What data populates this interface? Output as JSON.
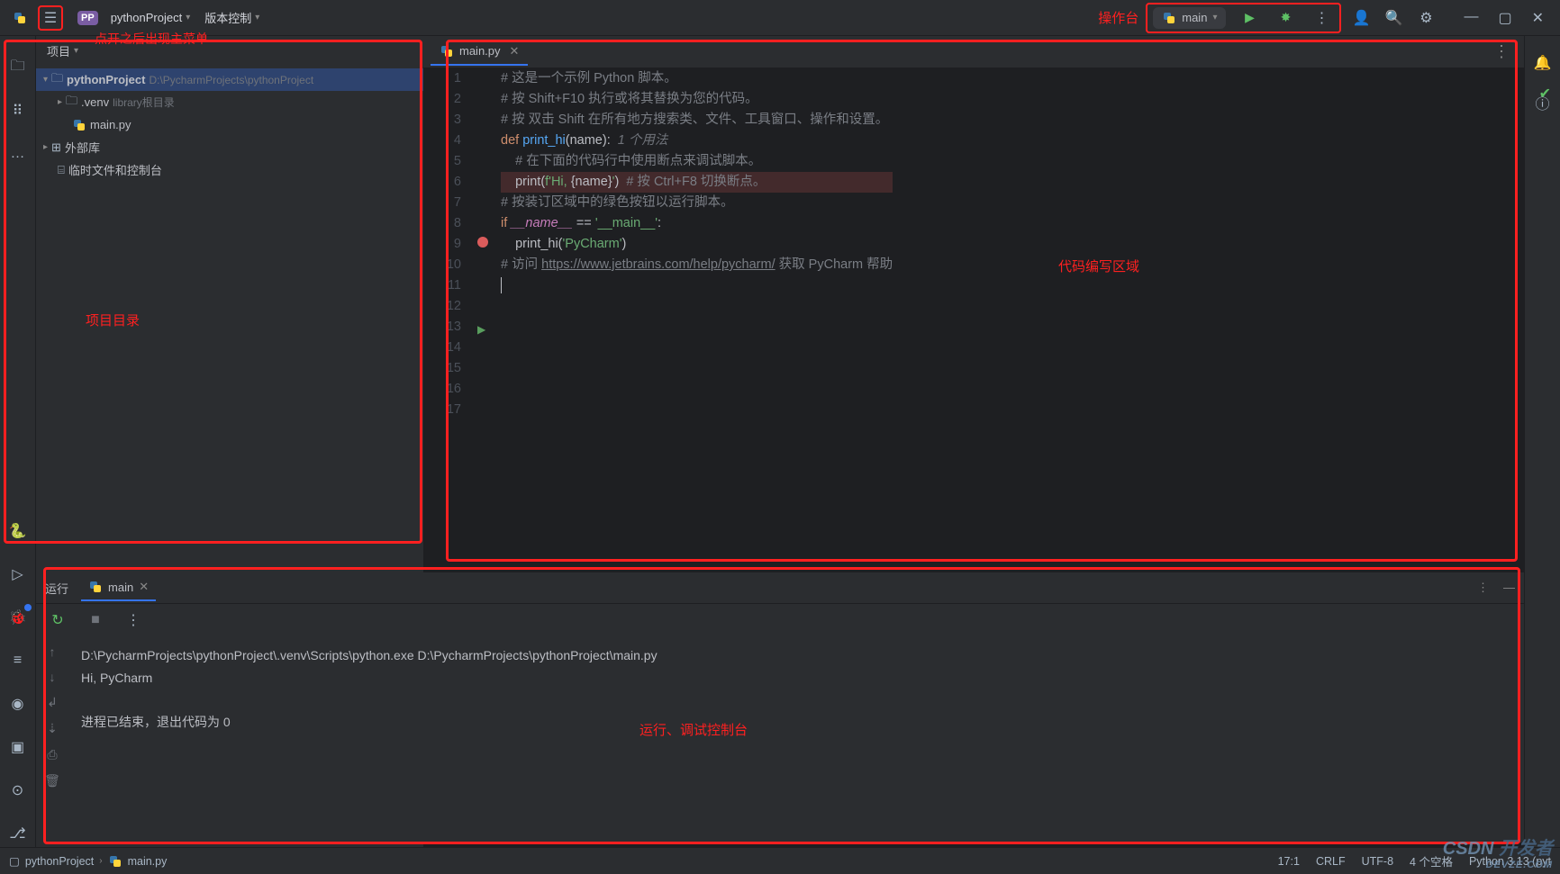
{
  "topbar": {
    "project_badge": "PP",
    "project_name": "pythonProject",
    "vcs_label": "版本控制",
    "run_config": "main"
  },
  "annotations": {
    "menu_hint": "点开之后出现主菜单",
    "toolbar": "操作台",
    "project_tree": "项目目录",
    "editor": "代码编写区域",
    "console": "运行、调试控制台"
  },
  "project_panel": {
    "title": "项目",
    "tree": {
      "root": "pythonProject",
      "root_path": "D:\\PycharmProjects\\pythonProject",
      "venv": ".venv",
      "venv_hint": "library根目录",
      "file1": "main.py",
      "ext_lib": "外部库",
      "scratch": "临时文件和控制台"
    }
  },
  "editor": {
    "tab": "main.py",
    "lines": [
      "# 这是一个示例 Python 脚本。",
      "",
      "# 按 Shift+F10 执行或将其替换为您的代码。",
      "# 按 双击 Shift 在所有地方搜索类、文件、工具窗口、操作和设置。",
      "",
      "",
      "def print_hi(name):",
      "    # 在下面的代码行中使用断点来调试脚本。",
      "    print(f'Hi, {name}')  # 按 Ctrl+F8 切换断点。",
      "",
      "",
      "# 按装订区域中的绿色按钮以运行脚本。",
      "if __name__ == '__main__':",
      "    print_hi('PyCharm')",
      "",
      "# 访问 https://www.jetbrains.com/help/pycharm/ 获取 PyCharm 帮助",
      ""
    ],
    "usage_hint": "1 个用法",
    "help_url": "https://www.jetbrains.com/help/pycharm/"
  },
  "run": {
    "title": "运行",
    "tab": "main",
    "output_cmd": "D:\\PycharmProjects\\pythonProject\\.venv\\Scripts\\python.exe D:\\PycharmProjects\\pythonProject\\main.py",
    "output_line": "Hi, PyCharm",
    "output_exit": "进程已结束，退出代码为 0"
  },
  "statusbar": {
    "breadcrumb1": "pythonProject",
    "breadcrumb2": "main.py",
    "pos": "17:1",
    "eol": "CRLF",
    "encoding": "UTF-8",
    "indent": "4 个空格",
    "interpreter": "Python 3.13 (pyt"
  },
  "watermark": {
    "main": "CSDN",
    "sub": "DEVZE.COM",
    "side": "开发者"
  }
}
